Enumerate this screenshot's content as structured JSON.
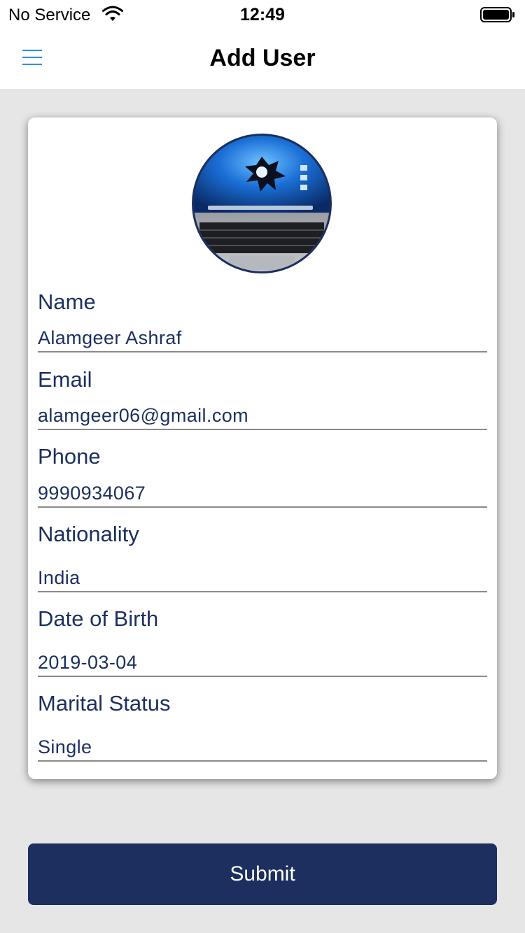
{
  "status_bar": {
    "carrier": "No Service",
    "time": "12:49"
  },
  "nav": {
    "title": "Add User",
    "menu_icon": "hamburger-menu-icon",
    "accent_color": "#2f8ee6"
  },
  "form": {
    "avatar_icon": "laptop-photo",
    "fields": [
      {
        "label": "Name",
        "value": "Alamgeer Ashraf"
      },
      {
        "label": "Email",
        "value": "alamgeer06@gmail.com"
      },
      {
        "label": "Phone",
        "value": "9990934067"
      },
      {
        "label": "Nationality",
        "value": "India"
      },
      {
        "label": "Date of Birth",
        "value": "2019-03-04"
      },
      {
        "label": "Marital Status",
        "value": "Single"
      }
    ]
  },
  "submit": {
    "label": "Submit",
    "color": "#1c2f5e"
  }
}
